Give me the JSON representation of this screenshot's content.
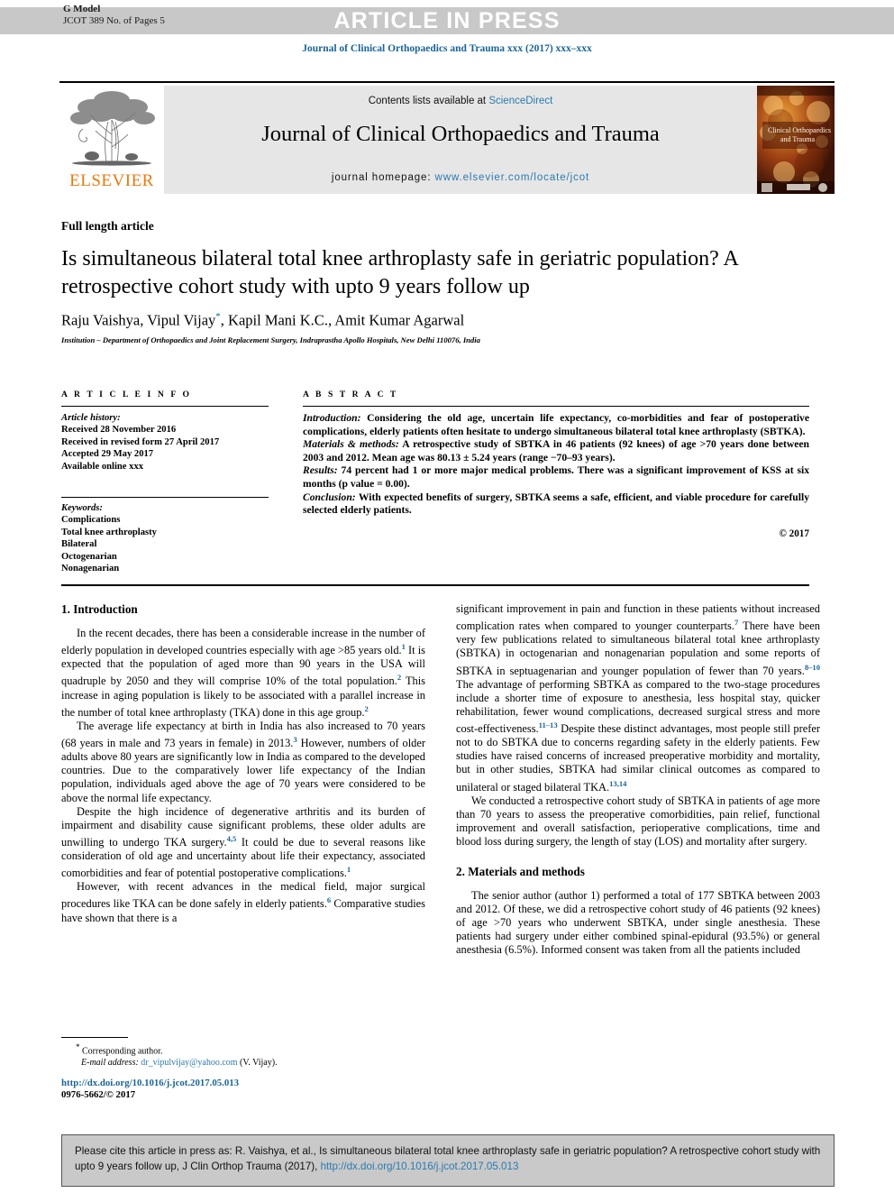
{
  "header": {
    "g_model_line1": "G Model",
    "g_model_line2": "JCOT 389 No. of Pages 5",
    "article_in_press": "ARTICLE IN PRESS",
    "journal_reference": "Journal of Clinical Orthopaedics and Trauma xxx (2017) xxx–xxx"
  },
  "masthead": {
    "publisher_name": "ELSEVIER",
    "contents_prefix": "Contents lists available at ",
    "contents_link": "ScienceDirect",
    "journal_title": "Journal of Clinical Orthopaedics and Trauma",
    "homepage_prefix": "journal homepage: ",
    "homepage_url": "www.elsevier.com/locate/jcot",
    "cover_title_line1": "Clinical Orthopaedics",
    "cover_title_line2": "and Trauma"
  },
  "article": {
    "type_label": "Full length article",
    "title": "Is simultaneous bilateral total knee arthroplasty safe in geriatric population? A retrospective cohort study with upto 9 years follow up",
    "authors_pre": "Raju Vaishya, Vipul Vijay",
    "author_star": "*",
    "authors_post": ", Kapil Mani K.C., Amit Kumar Agarwal",
    "institution": "Institution – Department of Orthopaedics and Joint Replacement Surgery, Indraprastha Apollo Hospitals, New Delhi 110076, India"
  },
  "article_info": {
    "heading": "A R T I C L E   I N F O",
    "history_label": "Article history:",
    "history": [
      "Received 28 November 2016",
      "Received in revised form 27 April 2017",
      "Accepted 29 May 2017",
      "Available online xxx"
    ],
    "keywords_label": "Keywords:",
    "keywords": [
      "Complications",
      "Total knee arthroplasty",
      "Bilateral",
      "Octogenarian",
      "Nonagenarian"
    ]
  },
  "abstract": {
    "heading": "A B S T R A C T",
    "intro_label": "Introduction:",
    "intro_text": " Considering the old age, uncertain life expectancy, co-morbidities and fear of postoperative complications, elderly patients often hesitate to undergo simultaneous bilateral total knee arthroplasty (SBTKA).",
    "methods_label": "Materials & methods:",
    "methods_text": " A retrospective study of SBTKA in 46 patients (92 knees) of age >70 years done between 2003 and 2012. Mean age was 80.13 ± 5.24 years (range −70–93 years).",
    "results_label": "Results:",
    "results_text": " 74 percent had 1 or more major medical problems. There was a significant improvement of KSS at six months (p value = 0.00).",
    "conclusion_label": "Conclusion:",
    "conclusion_text": " With expected benefits of surgery, SBTKA seems a safe, efficient, and viable procedure for carefully selected elderly patients.",
    "copyright": "© 2017"
  },
  "body": {
    "section1_heading": "1. Introduction",
    "section2_heading": "2. Materials and methods",
    "left_paragraphs": [
      "In the recent decades, there has been a considerable increase in the number of elderly population in developed countries especially with age >85 years old.<sup>1</sup> It is expected that the population of aged more than 90 years in the USA will quadruple by 2050 and they will comprise 10% of the total population.<sup>2</sup> This increase in aging population is likely to be associated with a parallel increase in the number of total knee arthroplasty (TKA) done in this age group.<sup>2</sup>",
      "The average life expectancy at birth in India has also increased to 70 years (68 years in male and 73 years in female) in 2013.<sup>3</sup> However, numbers of older adults above 80 years are significantly low in India as compared to the developed countries. Due to the comparatively lower life expectancy of the Indian population, individuals aged above the age of 70 years were considered to be above the normal life expectancy.",
      "Despite the high incidence of degenerative arthritis and its burden of impairment and disability cause significant problems, these older adults are unwilling to undergo TKA surgery.<sup>4,5</sup> It could be due to several reasons like consideration of old age and uncertainty about life their expectancy, associated comorbidities and fear of potential postoperative complications.<sup>1</sup>",
      "However, with recent advances in the medical field, major surgical procedures like TKA can be done safely in elderly patients.<sup>6</sup> Comparative studies have shown that there is a"
    ],
    "right_paragraphs": [
      "significant improvement in pain and function in these patients without increased complication rates when compared to younger counterparts.<sup>7</sup> There have been very few publications related to simultaneous bilateral total knee arthroplasty (SBTKA) in octogenarian and nonagenarian population and some reports of SBTKA in septuagenarian and younger population of fewer than 70 years.<sup>8–10</sup> The advantage of performing SBTKA as compared to the two-stage procedures include a shorter time of exposure to anesthesia, less hospital stay, quicker rehabilitation, fewer wound complications, decreased surgical stress and more cost-effectiveness.<sup>11–13</sup> Despite these distinct advantages, most people still prefer not to do SBTKA due to concerns regarding safety in the elderly patients. Few studies have raised concerns of increased preoperative morbidity and mortality, but in other studies, SBTKA had similar clinical outcomes as compared to unilateral or staged bilateral TKA.<sup>13,14</sup>",
      "We conducted a retrospective cohort study of SBTKA in patients of age more than 70 years to assess the preoperative comorbidities, pain relief, functional improvement and overall satisfaction, perioperative complications, time and blood loss during surgery, the length of stay (LOS) and mortality after surgery."
    ],
    "right_paragraphs_after_heading": [
      "The senior author (author 1) performed a total of 177 SBTKA between 2003 and 2012. Of these, we did a retrospective cohort study of 46 patients (92 knees) of age >70 years who underwent SBTKA, under single anesthesia. These patients had surgery under either combined spinal-epidural (93.5%) or general anesthesia (6.5%). Informed consent was taken from all the patients included"
    ]
  },
  "footnote": {
    "star": "*",
    "corresponding": "Corresponding author.",
    "email_label": "E-mail address:",
    "email": "dr_vipulvijay@yahoo.com",
    "email_suffix": " (V. Vijay).",
    "doi_url": "http://dx.doi.org/10.1016/j.jcot.2017.05.013",
    "issn_line": "0976-5662/© 2017"
  },
  "citation_box": {
    "text_pre": "Please cite this article in press as: R. Vaishya, et al., Is simultaneous bilateral total knee arthroplasty safe in geriatric population? A retrospective cohort study with upto 9 years follow up, J Clin Orthop Trauma (2017), ",
    "link": "http://dx.doi.org/10.1016/j.jcot.2017.05.013"
  },
  "colors": {
    "link_blue": "#2a7ab0",
    "heading_blue": "#1a6496",
    "elsevier_orange": "#E8790C",
    "band_gray": "#c8c8c8",
    "masthead_gray": "#e6e6e6",
    "cite_gray": "#c9c9c9"
  }
}
